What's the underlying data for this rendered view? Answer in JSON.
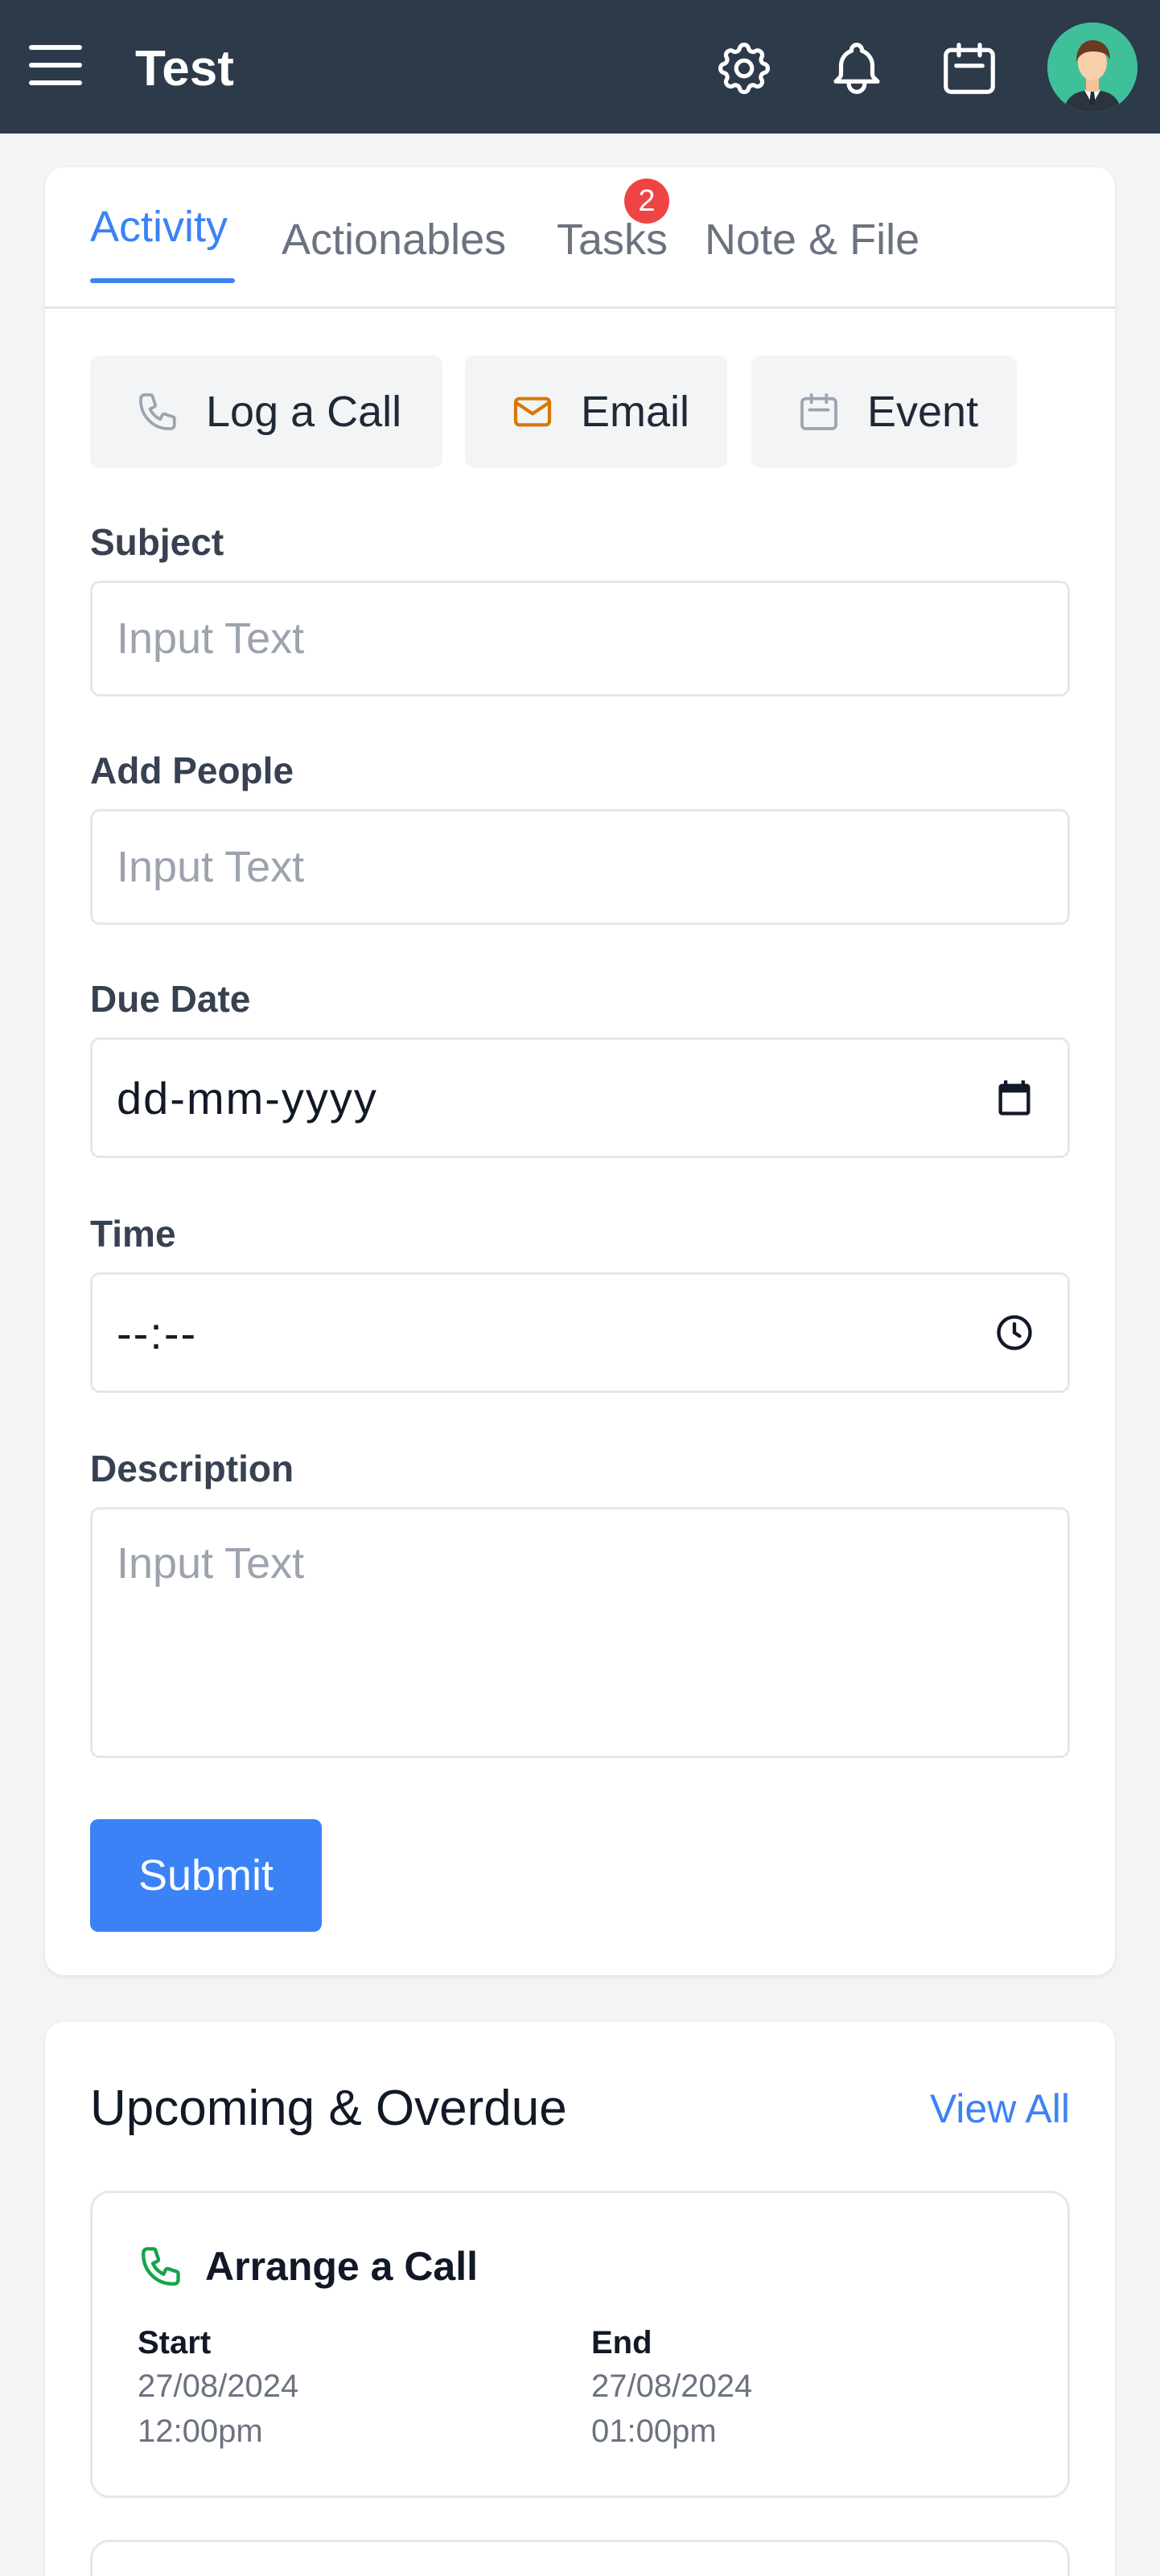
{
  "header": {
    "title": "Test",
    "icons": [
      "menu-icon",
      "gear-icon",
      "bell-icon",
      "calendar-icon",
      "avatar"
    ]
  },
  "tabs": [
    {
      "label": "Activity",
      "active": true
    },
    {
      "label": "Actionables",
      "active": false
    },
    {
      "label": "Tasks",
      "active": false,
      "badge": "2"
    },
    {
      "label": "Note & File",
      "active": false
    }
  ],
  "activity_types": [
    {
      "label": "Log a Call",
      "icon": "phone-icon"
    },
    {
      "label": "Email",
      "icon": "mail-icon",
      "icon_color": "#d97706"
    },
    {
      "label": "Event",
      "icon": "calendar-icon"
    }
  ],
  "form": {
    "subject": {
      "label": "Subject",
      "placeholder": "Input Text",
      "value": ""
    },
    "add_people": {
      "label": "Add People",
      "placeholder": "Input Text",
      "value": ""
    },
    "due_date": {
      "label": "Due Date",
      "value": "dd-mm-yyyy"
    },
    "time": {
      "label": "Time",
      "value": "--:--"
    },
    "description": {
      "label": "Description",
      "placeholder": "Input Text",
      "value": ""
    },
    "submit_label": "Submit"
  },
  "upcoming": {
    "title": "Upcoming & Overdue",
    "view_all": "View All",
    "items": [
      {
        "title": "Arrange a Call",
        "icon": "phone-icon",
        "icon_color": "#16a34a",
        "start_label": "Start",
        "start_date": "27/08/2024",
        "start_time": "12:00pm",
        "end_label": "End",
        "end_date": "27/08/2024",
        "end_time": "01:00pm"
      }
    ]
  },
  "colors": {
    "header_bg": "#2d3a4a",
    "accent": "#3b82f6",
    "badge": "#ef4444"
  }
}
